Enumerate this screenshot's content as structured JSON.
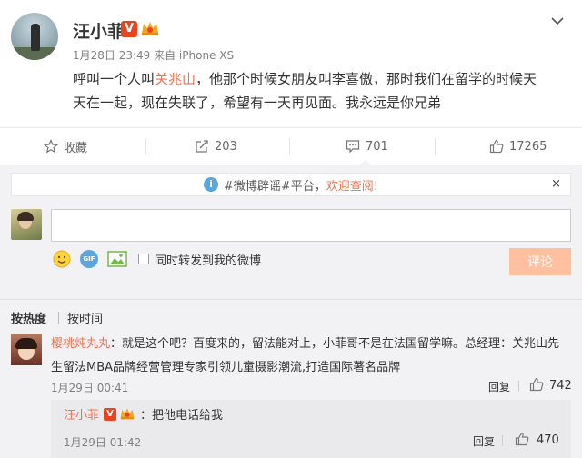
{
  "post": {
    "author": "汪小菲",
    "vip_mark": "V",
    "meta": "1月28日 23:49 来自 iPhone XS",
    "body_before": "呼叫一个人叫",
    "mention": "关兆山",
    "body_after": "，他那个时候女朋友叫李喜傲，那时我们在留学的时候天天在一起，现在失联了，希望有一天再见面。我永远是你兄弟"
  },
  "actions": {
    "favorite_label": "收藏",
    "repost_count": "203",
    "comment_count": "701",
    "like_count": "17265"
  },
  "notice": {
    "text_prefix": "#微博辟谣#平台，",
    "text_highlight": "欢迎查阅!",
    "close_glyph": "×"
  },
  "composer": {
    "input_value": "",
    "gif_label": "GIF",
    "forward_label": "同时转发到我的微博",
    "submit_label": "评论"
  },
  "sort": {
    "hot_label": "按热度",
    "time_label": "按时间"
  },
  "comments": [
    {
      "user": "樱桃炖丸丸",
      "text": "：就是这个吧？百度来的，留法能对上，小菲哥不是在法国留学嘛。总经理：关兆山先生留法MBA品牌经营管理专家引领儿童摄影潮流,打造国际著名品牌",
      "time": "1月29日 00:41",
      "reply_label": "回复",
      "likes": "742",
      "replies": [
        {
          "user": "汪小菲",
          "vip_mark": "V",
          "text": "：把他电话给我",
          "time": "1月29日 01:42",
          "reply_label": "回复",
          "likes": "470"
        }
      ]
    }
  ],
  "colors": {
    "accent": "#eb7350",
    "vip": "#e8451f",
    "info": "#5aa6df",
    "submit_disabled": "#ffc09f"
  }
}
